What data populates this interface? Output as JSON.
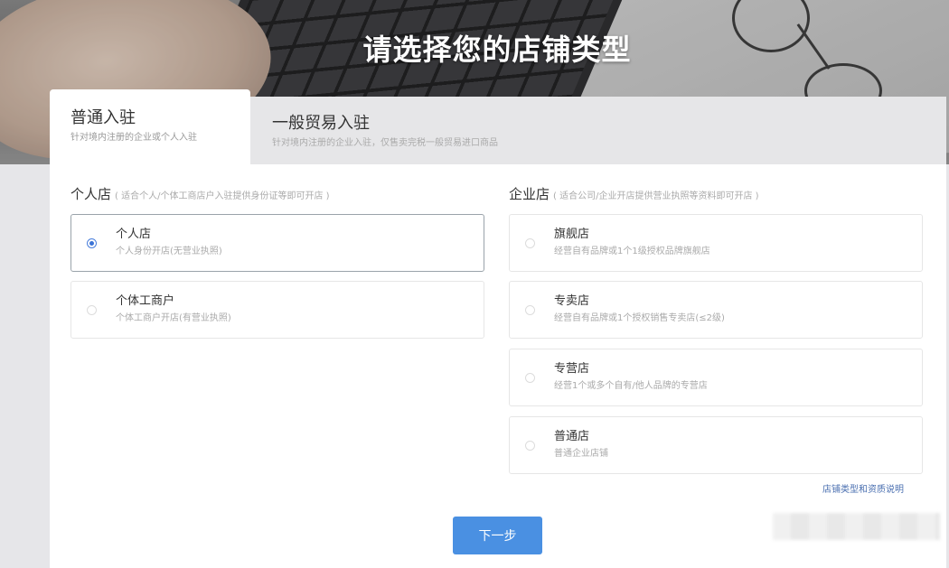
{
  "page_title": "请选择您的店铺类型",
  "tabs": [
    {
      "title": "普通入驻",
      "subtitle": "针对境内注册的企业或个人入驻",
      "active": true
    },
    {
      "title": "一般贸易入驻",
      "subtitle": "针对境内注册的企业入驻，仅售卖完税一般贸易进口商品",
      "active": false
    }
  ],
  "personal": {
    "heading": "个人店",
    "note": "( 适合个人/个体工商店户入驻提供身份证等即可开店 )",
    "options": [
      {
        "title": "个人店",
        "desc": "个人身份开店(无营业执照)",
        "selected": true
      },
      {
        "title": "个体工商户",
        "desc": "个体工商户开店(有营业执照)",
        "selected": false
      }
    ]
  },
  "enterprise": {
    "heading": "企业店",
    "note": "( 适合公司/企业开店提供营业执照等资料即可开店 )",
    "options": [
      {
        "title": "旗舰店",
        "desc": "经营自有品牌或1个1级授权品牌旗舰店",
        "selected": false
      },
      {
        "title": "专卖店",
        "desc": "经营自有品牌或1个授权销售专卖店(≤2级)",
        "selected": false
      },
      {
        "title": "专营店",
        "desc": "经营1个或多个自有/他人品牌的专营店",
        "selected": false
      },
      {
        "title": "普通店",
        "desc": "普通企业店铺",
        "selected": false
      }
    ]
  },
  "help_link": "店铺类型和资质说明",
  "next_button": "下一步",
  "colors": {
    "accent": "#4a90e2",
    "radio_selected": "#3b73d6",
    "link": "#4a6fb0"
  }
}
